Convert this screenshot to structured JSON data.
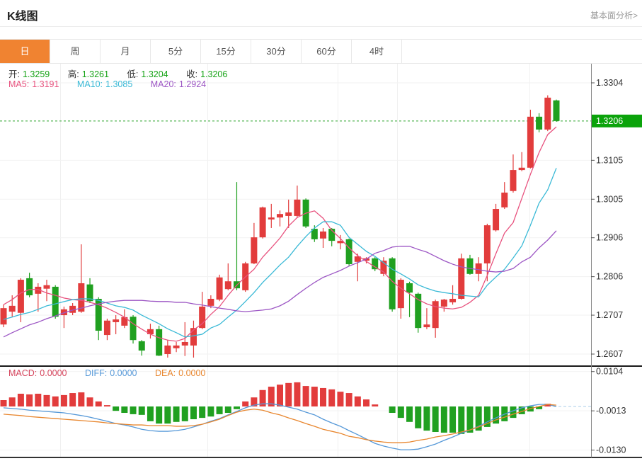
{
  "header": {
    "title": "K线图",
    "link": "基本面分析>"
  },
  "tabs": {
    "items": [
      "日",
      "周",
      "月",
      "5分",
      "15分",
      "30分",
      "60分",
      "4时"
    ],
    "active_index": 0
  },
  "legend": {
    "ohlc": [
      {
        "label": "开:",
        "value": "1.3259"
      },
      {
        "label": "高:",
        "value": "1.3261"
      },
      {
        "label": "低:",
        "value": "1.3204"
      },
      {
        "label": "收:",
        "value": "1.3206"
      }
    ],
    "ma": [
      {
        "label": "MA5:",
        "value": "1.3191"
      },
      {
        "label": "MA10:",
        "value": "1.3085"
      },
      {
        "label": "MA20:",
        "value": "1.2924"
      }
    ]
  },
  "macd_legend": [
    {
      "label": "MACD:",
      "value": "0.0000"
    },
    {
      "label": "DIFF:",
      "value": "0.0000"
    },
    {
      "label": "DEA:",
      "value": "0.0000"
    }
  ],
  "colors": {
    "up": "#e23c3c",
    "down": "#20a020",
    "ma5": "#e8537f",
    "ma10": "#39b9d6",
    "ma20": "#9c56c4",
    "diff": "#5598d8",
    "dea": "#e8862e",
    "tab_active": "#f08331",
    "price_badge": "#0ba30b",
    "current_price_line": "#2fa52f",
    "axis_text": "#333333"
  },
  "chart_data": {
    "type": "candlestick",
    "title": "K线图",
    "legend_note": "red = up (涨), green = down (跌); sub-panel is MACD histogram with DIFF/DEA lines",
    "panels": [
      {
        "name": "price",
        "y_ticks": [
          1.3304,
          1.3105,
          1.3005,
          1.2906,
          1.2806,
          1.2707,
          1.2607
        ],
        "ylim": [
          1.2607,
          1.3335
        ],
        "current_price": 1.3206,
        "ohlc": [
          [
            1.2683,
            1.2734,
            1.2676,
            1.2725
          ],
          [
            1.2716,
            1.2758,
            1.2703,
            1.2731
          ],
          [
            1.2713,
            1.2802,
            1.2689,
            1.2798
          ],
          [
            1.2802,
            1.2816,
            1.2753,
            1.2758
          ],
          [
            1.2762,
            1.2789,
            1.2716,
            1.278
          ],
          [
            1.2775,
            1.2798,
            1.2743,
            1.2784
          ],
          [
            1.278,
            1.2784,
            1.2698,
            1.2703
          ],
          [
            1.2707,
            1.2729,
            1.2674,
            1.2722
          ],
          [
            1.2713,
            1.2738,
            1.2707,
            1.2731
          ],
          [
            1.2716,
            1.2889,
            1.2713,
            1.2789
          ],
          [
            1.2786,
            1.2802,
            1.2738,
            1.2743
          ],
          [
            1.2749,
            1.2753,
            1.2643,
            1.2667
          ],
          [
            1.2656,
            1.2698,
            1.2643,
            1.2693
          ],
          [
            1.2689,
            1.2707,
            1.2658,
            1.2696
          ],
          [
            1.268,
            1.2722,
            1.2674,
            1.2702
          ],
          [
            1.2703,
            1.2707,
            1.2634,
            1.2643
          ],
          [
            1.264,
            1.2643,
            1.2603,
            1.2616
          ],
          [
            1.2658,
            1.2685,
            1.2647,
            1.2671
          ],
          [
            1.2671,
            1.268,
            1.2602,
            1.2603
          ],
          [
            1.2607,
            1.2643,
            1.2598,
            1.2629
          ],
          [
            1.2622,
            1.2638,
            1.2612,
            1.2629
          ],
          [
            1.2629,
            1.2689,
            1.2602,
            1.2638
          ],
          [
            1.2629,
            1.2693,
            1.2598,
            1.2674
          ],
          [
            1.2674,
            1.2767,
            1.2671,
            1.2729
          ],
          [
            1.2731,
            1.2758,
            1.2725,
            1.2749
          ],
          [
            1.2747,
            1.2811,
            1.2743,
            1.2804
          ],
          [
            1.2774,
            1.284,
            1.2771,
            1.2794
          ],
          [
            1.2794,
            1.3049,
            1.2771,
            1.2776
          ],
          [
            1.2771,
            1.2844,
            1.2767,
            1.284
          ],
          [
            1.284,
            1.2944,
            1.2838,
            1.2907
          ],
          [
            1.2907,
            1.2986,
            1.2904,
            1.2984
          ],
          [
            1.2953,
            1.2993,
            1.2931,
            1.2958
          ],
          [
            1.2958,
            1.2976,
            1.2935,
            1.2967
          ],
          [
            1.2962,
            1.3004,
            1.2931,
            1.2971
          ],
          [
            1.2962,
            1.304,
            1.2958,
            1.3004
          ],
          [
            1.3004,
            1.3007,
            1.2931,
            1.2935
          ],
          [
            1.2929,
            1.2938,
            1.2895,
            1.2902
          ],
          [
            1.2904,
            1.2931,
            1.288,
            1.2922
          ],
          [
            1.2929,
            1.2931,
            1.2884,
            1.2898
          ],
          [
            1.2892,
            1.2913,
            1.2876,
            1.2898
          ],
          [
            1.2902,
            1.2904,
            1.2834,
            1.2838
          ],
          [
            1.2844,
            1.2865,
            1.2794,
            1.2858
          ],
          [
            1.2847,
            1.2856,
            1.284,
            1.2853
          ],
          [
            1.2853,
            1.2856,
            1.282,
            1.2825
          ],
          [
            1.2813,
            1.2856,
            1.2807,
            1.2847
          ],
          [
            1.2853,
            1.2856,
            1.2716,
            1.2722
          ],
          [
            1.2725,
            1.2802,
            1.2698,
            1.2798
          ],
          [
            1.2789,
            1.2793,
            1.2702,
            1.2765
          ],
          [
            1.2762,
            1.2765,
            1.2662,
            1.2674
          ],
          [
            1.2676,
            1.2725,
            1.2671,
            1.2683
          ],
          [
            1.2674,
            1.2747,
            1.2649,
            1.2743
          ],
          [
            1.2729,
            1.2749,
            1.2716,
            1.2747
          ],
          [
            1.274,
            1.2784,
            1.2734,
            1.2749
          ],
          [
            1.2749,
            1.2865,
            1.2747,
            1.2853
          ],
          [
            1.2853,
            1.2862,
            1.2811,
            1.2813
          ],
          [
            1.2813,
            1.2856,
            1.2794,
            1.284
          ],
          [
            1.284,
            1.2942,
            1.2794,
            1.2938
          ],
          [
            1.2925,
            1.2993,
            1.2922,
            1.298
          ],
          [
            1.2984,
            1.3049,
            1.298,
            1.3022
          ],
          [
            1.3026,
            1.312,
            1.3022,
            1.308
          ],
          [
            1.308,
            1.3126,
            1.3077,
            1.3086
          ],
          [
            1.3086,
            1.3235,
            1.3084,
            1.3217
          ],
          [
            1.3217,
            1.3226,
            1.3177,
            1.3184
          ],
          [
            1.3184,
            1.3272,
            1.318,
            1.3266
          ],
          [
            1.3259,
            1.3261,
            1.3204,
            1.3206
          ]
        ],
        "ma5": [
          1.2734,
          1.2747,
          1.2764,
          1.2773,
          1.2773,
          1.2764,
          1.2758,
          1.2751,
          1.2747,
          1.2745,
          1.274,
          1.2734,
          1.2725,
          1.2714,
          1.2702,
          1.2685,
          1.2671,
          1.2658,
          1.2649,
          1.2643,
          1.264,
          1.2647,
          1.2669,
          1.2685,
          1.2709,
          1.2729,
          1.2758,
          1.2784,
          1.2805,
          1.2825,
          1.2856,
          1.288,
          1.2905,
          1.2936,
          1.2958,
          1.2969,
          1.2975,
          1.2956,
          1.2925,
          1.2904,
          1.288,
          1.286,
          1.2845,
          1.2831,
          1.2818,
          1.2794,
          1.2776,
          1.2762,
          1.2747,
          1.2736,
          1.2729,
          1.2725,
          1.2723,
          1.2727,
          1.274,
          1.2758,
          1.2809,
          1.2865,
          1.2918,
          1.2945,
          1.3007,
          1.3069,
          1.3125,
          1.3171,
          1.3191
        ],
        "ma10": [
          1.2696,
          1.2702,
          1.2709,
          1.2714,
          1.2722,
          1.2731,
          1.2736,
          1.2742,
          1.2747,
          1.2749,
          1.2749,
          1.2745,
          1.2738,
          1.2731,
          1.2727,
          1.272,
          1.2707,
          1.2696,
          1.2685,
          1.2672,
          1.2662,
          1.2651,
          1.2654,
          1.2658,
          1.2674,
          1.2683,
          1.2702,
          1.272,
          1.2742,
          1.2765,
          1.2791,
          1.2813,
          1.2836,
          1.2856,
          1.2884,
          1.2909,
          1.2931,
          1.2947,
          1.2947,
          1.2938,
          1.2907,
          1.2889,
          1.2871,
          1.2858,
          1.2842,
          1.2825,
          1.2813,
          1.28,
          1.2785,
          1.2776,
          1.2769,
          1.2765,
          1.2762,
          1.2758,
          1.2756,
          1.2754,
          1.2784,
          1.2805,
          1.2825,
          1.2854,
          1.2885,
          1.2938,
          1.2995,
          1.3029,
          1.3085
        ],
        "ma20": [
          1.2651,
          1.2662,
          1.2672,
          1.2682,
          1.2689,
          1.2698,
          1.2705,
          1.2713,
          1.272,
          1.2725,
          1.2731,
          1.2736,
          1.274,
          1.2743,
          1.2745,
          1.2745,
          1.2745,
          1.2743,
          1.2742,
          1.2742,
          1.274,
          1.274,
          1.2736,
          1.2733,
          1.2729,
          1.2725,
          1.2722,
          1.2718,
          1.2716,
          1.2718,
          1.272,
          1.2723,
          1.2731,
          1.2743,
          1.276,
          1.2776,
          1.2791,
          1.2804,
          1.2813,
          1.2822,
          1.2833,
          1.2842,
          1.2851,
          1.2866,
          1.2873,
          1.2882,
          1.2884,
          1.2884,
          1.2876,
          1.2869,
          1.2858,
          1.2847,
          1.2838,
          1.2831,
          1.2827,
          1.2824,
          1.282,
          1.2818,
          1.282,
          1.2827,
          1.2844,
          1.2856,
          1.288,
          1.29,
          1.2924
        ]
      },
      {
        "name": "macd",
        "y_ticks": [
          0.0104,
          -0.0013,
          -0.013
        ],
        "ylim": [
          -0.0155,
          0.0125
        ],
        "histogram": [
          0.0019,
          0.0027,
          0.0038,
          0.0036,
          0.0038,
          0.0034,
          0.003,
          0.0034,
          0.004,
          0.0042,
          0.0027,
          0.0015,
          0.0004,
          -0.0013,
          -0.0019,
          -0.0023,
          -0.0025,
          -0.0044,
          -0.0051,
          -0.0051,
          -0.0046,
          -0.0044,
          -0.0038,
          -0.0034,
          -0.003,
          -0.0023,
          -0.0019,
          -0.0008,
          0.0015,
          0.0027,
          0.0049,
          0.0059,
          0.0065,
          0.007,
          0.0072,
          0.0061,
          0.0059,
          0.0055,
          0.0051,
          0.0044,
          0.004,
          0.003,
          0.0021,
          0.0006,
          0.0,
          -0.0019,
          -0.0034,
          -0.0046,
          -0.0065,
          -0.0072,
          -0.0076,
          -0.0078,
          -0.0078,
          -0.0082,
          -0.0078,
          -0.0072,
          -0.0061,
          -0.0051,
          -0.0044,
          -0.0034,
          -0.0023,
          -0.0015,
          -0.0008,
          0.0008,
          0.0
        ],
        "diff": [
          -0.0004,
          -0.0006,
          -0.0008,
          -0.0011,
          -0.0013,
          -0.0015,
          -0.0017,
          -0.0019,
          -0.0023,
          -0.0027,
          -0.0032,
          -0.0038,
          -0.0044,
          -0.0051,
          -0.0055,
          -0.0061,
          -0.0068,
          -0.0072,
          -0.0074,
          -0.0074,
          -0.0072,
          -0.0068,
          -0.0061,
          -0.0053,
          -0.0044,
          -0.0036,
          -0.0025,
          -0.0015,
          -0.0004,
          0.0004,
          0.0008,
          0.0008,
          0.0004,
          -0.0002,
          -0.0008,
          -0.0017,
          -0.0025,
          -0.0038,
          -0.0049,
          -0.0059,
          -0.0072,
          -0.0084,
          -0.0097,
          -0.011,
          -0.0118,
          -0.0124,
          -0.0129,
          -0.0129,
          -0.0127,
          -0.012,
          -0.0112,
          -0.0101,
          -0.0091,
          -0.008,
          -0.007,
          -0.0059,
          -0.0046,
          -0.0034,
          -0.0023,
          -0.0013,
          -0.0004,
          0.0002,
          0.0006,
          0.0006,
          0.0
        ],
        "dea": [
          -0.0023,
          -0.0025,
          -0.0027,
          -0.003,
          -0.0032,
          -0.0034,
          -0.0036,
          -0.0038,
          -0.004,
          -0.0042,
          -0.0044,
          -0.0046,
          -0.0049,
          -0.0051,
          -0.0053,
          -0.0055,
          -0.0055,
          -0.0057,
          -0.0057,
          -0.0057,
          -0.0059,
          -0.0059,
          -0.0057,
          -0.0053,
          -0.0046,
          -0.0038,
          -0.0027,
          -0.0017,
          -0.0011,
          -0.0008,
          -0.0011,
          -0.0019,
          -0.0025,
          -0.0034,
          -0.0042,
          -0.0051,
          -0.0059,
          -0.0068,
          -0.0074,
          -0.008,
          -0.0089,
          -0.0093,
          -0.0099,
          -0.0103,
          -0.0106,
          -0.0108,
          -0.0108,
          -0.0106,
          -0.0101,
          -0.0097,
          -0.0091,
          -0.0087,
          -0.0082,
          -0.0076,
          -0.007,
          -0.0061,
          -0.0051,
          -0.004,
          -0.0032,
          -0.0023,
          -0.0015,
          -0.0006,
          0.0,
          0.0006,
          0.0004
        ]
      }
    ]
  }
}
